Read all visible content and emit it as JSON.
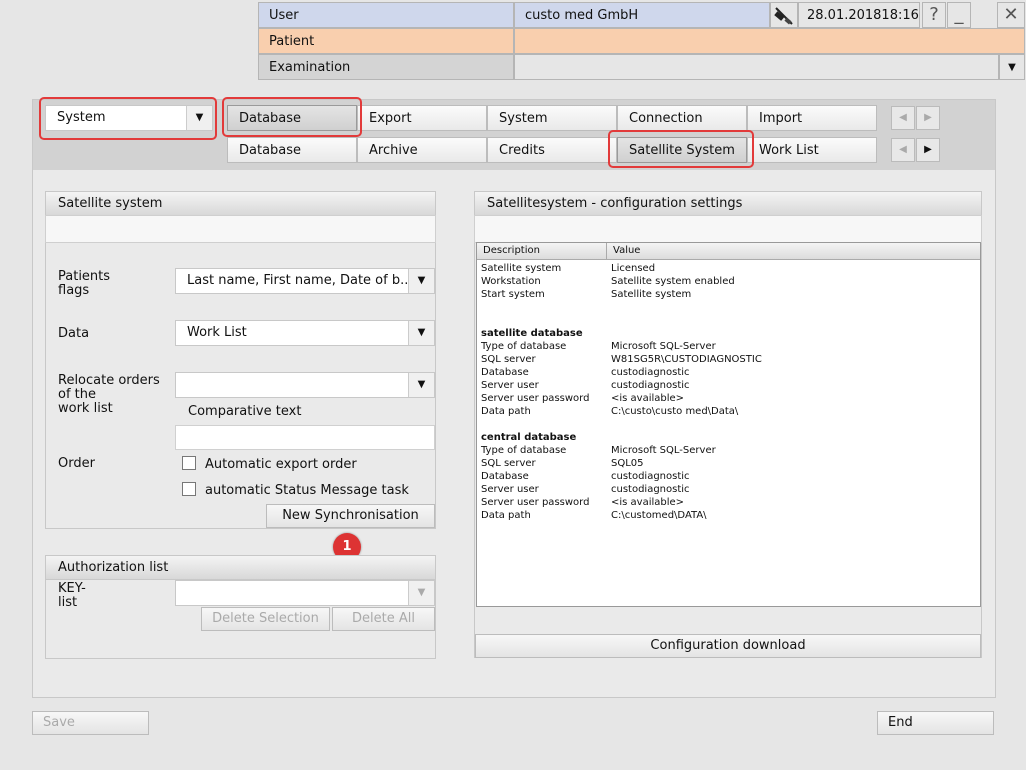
{
  "header": {
    "user_label": "User",
    "user_value": "custo med GmbH",
    "datetime": "28.01.201818:16",
    "patient_label": "Patient",
    "patient_value": "",
    "examination_label": "Examination",
    "examination_value": ""
  },
  "window": {
    "help_glyph": "?",
    "minimize_glyph": "_",
    "close_glyph": "✕"
  },
  "top_combo": {
    "value": "System"
  },
  "tabs_row1": [
    "Database",
    "Export",
    "System",
    "Connection",
    "Import"
  ],
  "tabs_row2": [
    "Database",
    "Archive",
    "Credits",
    "Satellite System",
    "Work List"
  ],
  "left_panel": {
    "title": "Satellite system",
    "patients_flags_label": "Patients\nflags",
    "patients_flags_value": "Last name, First name, Date of b...",
    "data_label": "Data",
    "data_value": "Work List",
    "relocate_label": "Relocate orders\nof the\nwork list",
    "relocate_value": "",
    "comparative_text_label": "Comparative text",
    "comparative_text_value": "",
    "order_label": "Order",
    "auto_export_label": "Automatic export order",
    "auto_status_label": "automatic Status Message task",
    "new_sync_button": "New Synchronisation"
  },
  "auth_panel": {
    "title": "Authorization list",
    "key_list_label": "KEY-\nlist",
    "key_list_value": "",
    "delete_selection_button": "Delete Selection",
    "delete_all_button": "Delete All"
  },
  "right_panel": {
    "title": "Satellitesystem - configuration settings",
    "col_description": "Description",
    "col_value": "Value",
    "rows": [
      {
        "d": "Satellite system",
        "v": "Licensed"
      },
      {
        "d": "Workstation",
        "v": "Satellite system enabled"
      },
      {
        "d": "Start system",
        "v": "Satellite system"
      },
      {
        "d": "",
        "v": ""
      },
      {
        "d": "",
        "v": ""
      },
      {
        "d": "satellite database",
        "v": "",
        "bold": true
      },
      {
        "d": "Type of database",
        "v": "Microsoft SQL-Server"
      },
      {
        "d": "SQL server",
        "v": "W81SG5R\\CUSTODIAGNOSTIC"
      },
      {
        "d": "Database",
        "v": "custodiagnostic"
      },
      {
        "d": "Server user",
        "v": "custodiagnostic"
      },
      {
        "d": "Server user password",
        "v": "<is available>"
      },
      {
        "d": "Data path",
        "v": "C:\\custo\\custo med\\Data\\"
      },
      {
        "d": "",
        "v": ""
      },
      {
        "d": "central database",
        "v": "",
        "bold": true
      },
      {
        "d": "Type of database",
        "v": "Microsoft SQL-Server"
      },
      {
        "d": "SQL server",
        "v": "SQL05"
      },
      {
        "d": "Database",
        "v": "custodiagnostic"
      },
      {
        "d": "Server user",
        "v": "custodiagnostic"
      },
      {
        "d": "Server user password",
        "v": "<is available>"
      },
      {
        "d": "Data path",
        "v": "C:\\customed\\DATA\\"
      }
    ],
    "config_download_button": "Configuration download"
  },
  "footer": {
    "save_button": "Save",
    "end_button": "End"
  },
  "annotation_badge": "1",
  "colors": {
    "highlight_red": "#e23a3a",
    "patient_bg": "#f9cfae",
    "user_bg": "#cfd7ec"
  }
}
